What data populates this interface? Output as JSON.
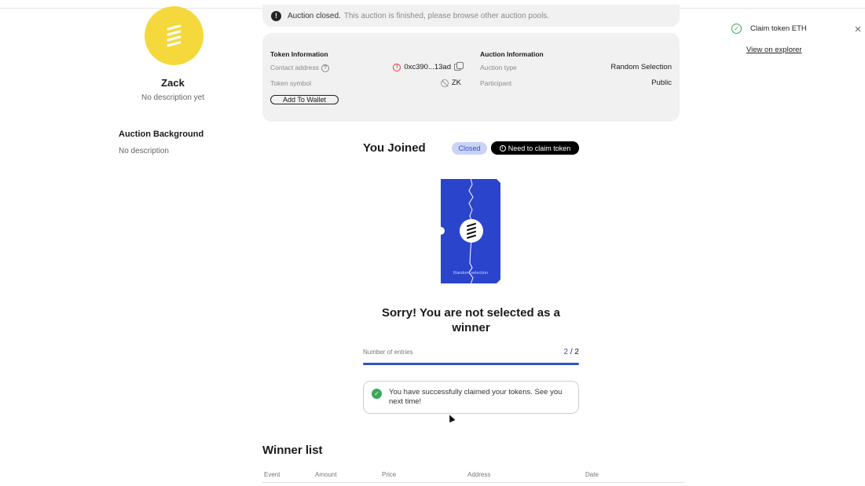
{
  "profile": {
    "name": "Zack",
    "description": "No description yet",
    "avatar_color": "#f5d93c",
    "background_title": "Auction Background",
    "background_desc": "No description"
  },
  "banner": {
    "icon": "warning-icon",
    "strong": "Auction closed.",
    "text": "This auction is finished, please browse other auction pools."
  },
  "token_info": {
    "header": "Token Information",
    "contact_label": "Contact address",
    "contact_value": "0xc390...13ad",
    "symbol_label": "Token symbol",
    "symbol_value": "ZK",
    "add_wallet": "Add To Wallet"
  },
  "auction_info": {
    "header": "Auction Information",
    "type_label": "Auction type",
    "type_value": "Random Selection",
    "participant_label": "Participant",
    "participant_value": "Public"
  },
  "joined": {
    "title": "You Joined",
    "status": "Closed",
    "claim_badge": "Need to claim token"
  },
  "ticket": {
    "label": "Random selection",
    "color": "#2b44cc"
  },
  "result": {
    "message": "Sorry! You are not selected as a winner",
    "entries_label": "Number of entries",
    "entries_current": "2",
    "entries_total": " / 2",
    "progress_fraction": 1.0,
    "success_message": "You have successfully claimed your tokens. See you next time!"
  },
  "winner_list": {
    "title": "Winner list",
    "columns": [
      "Event",
      "Amount",
      "Price",
      "Address",
      "Date"
    ]
  },
  "toast": {
    "title": "Claim token ETH",
    "link": "View on explorer"
  },
  "colors": {
    "accent": "#3452c8",
    "success": "#3aa85a",
    "error": "#e03a3a"
  }
}
